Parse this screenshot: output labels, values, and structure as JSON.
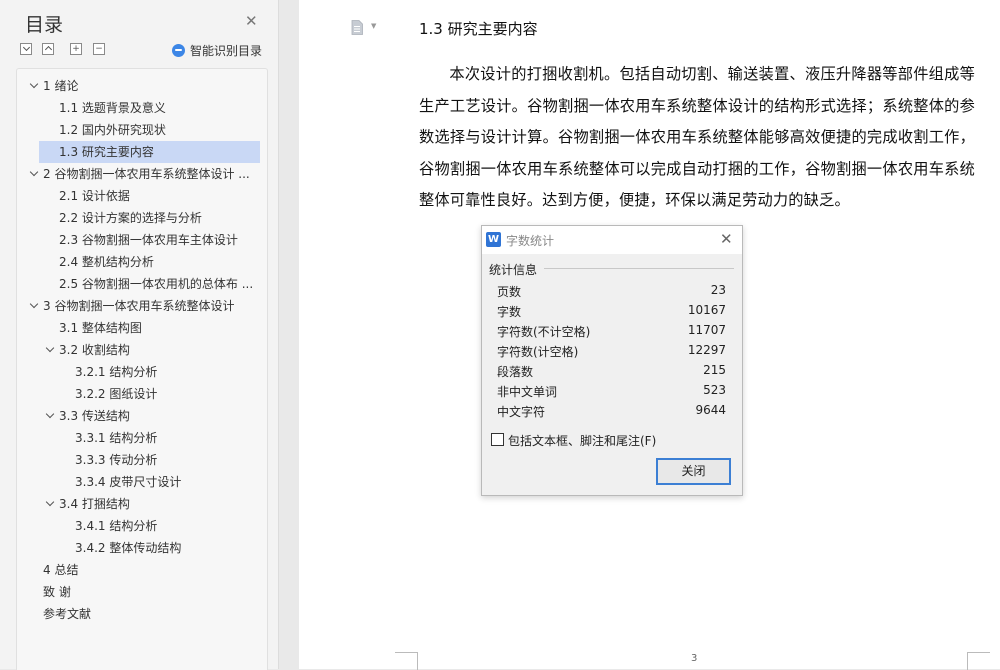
{
  "sidebar": {
    "title": "目录",
    "toolbar": {
      "collapse_all": "−",
      "expand": "+",
      "collapse": "−",
      "smart_label": "智能识别目录"
    },
    "items": [
      {
        "label": "1 绪论",
        "level": 0,
        "expander": "expanded"
      },
      {
        "label": "1.1 选题背景及意义",
        "level": 1
      },
      {
        "label": "1.2 国内外研究现状",
        "level": 1
      },
      {
        "label": "1.3 研究主要内容",
        "level": 1,
        "active": true
      },
      {
        "label": "2 谷物割捆一体农用车系统整体设计 ...",
        "level": 0,
        "expander": "expanded"
      },
      {
        "label": "2.1 设计依据",
        "level": 1
      },
      {
        "label": "2.2  设计方案的选择与分析",
        "level": 1
      },
      {
        "label": "2.3 谷物割捆一体农用车主体设计",
        "level": 1
      },
      {
        "label": "2.4 整机结构分析",
        "level": 1
      },
      {
        "label": "2.5 谷物割捆一体农用机的总体布 ...",
        "level": 1
      },
      {
        "label": "3 谷物割捆一体农用车系统整体设计",
        "level": 0,
        "expander": "expanded"
      },
      {
        "label": "3.1 整体结构图",
        "level": 1
      },
      {
        "label": "3.2 收割结构",
        "level": 1,
        "expander": "expanded"
      },
      {
        "label": "3.2.1 结构分析",
        "level": 2
      },
      {
        "label": "3.2.2 图纸设计",
        "level": 2
      },
      {
        "label": "3.3 传送结构",
        "level": 1,
        "expander": "expanded"
      },
      {
        "label": "3.3.1 结构分析",
        "level": 2
      },
      {
        "label": "3.3.3 传动分析",
        "level": 2
      },
      {
        "label": "3.3.4 皮带尺寸设计",
        "level": 2
      },
      {
        "label": "3.4 打捆结构",
        "level": 1,
        "expander": "expanded"
      },
      {
        "label": "3.4.1 结构分析",
        "level": 2
      },
      {
        "label": "3.4.2 整体传动结构",
        "level": 2
      },
      {
        "label": "4 总结",
        "level": 0
      },
      {
        "label": "致   谢",
        "level": 0
      },
      {
        "label": "参考文献",
        "level": 0
      }
    ]
  },
  "document": {
    "heading": "1.3 研究主要内容",
    "paragraph": "本次设计的打捆收割机。包括自动切割、输送装置、液压升降器等部件组成等生产工艺设计。谷物割捆一体农用车系统整体设计的结构形式选择；系统整体的参数选择与设计计算。谷物割捆一体农用车系统整体能够高效便捷的完成收割工作，谷物割捆一体农用车系统整体可以完成自动打捆的工作，谷物割捆一体农用车系统整体可靠性良好。达到方便，便捷，环保以满足劳动力的缺乏。",
    "page_number": "3"
  },
  "dialog": {
    "logo": "W",
    "title": "字数统计",
    "group_label": "统计信息",
    "stats": [
      {
        "label": "页数",
        "value": "23"
      },
      {
        "label": "字数",
        "value": "10167"
      },
      {
        "label": "字符数(不计空格)",
        "value": "11707"
      },
      {
        "label": "字符数(计空格)",
        "value": "12297"
      },
      {
        "label": "段落数",
        "value": "215"
      },
      {
        "label": "非中文单词",
        "value": "523"
      },
      {
        "label": "中文字符",
        "value": "9644"
      }
    ],
    "checkbox_label": "包括文本框、脚注和尾注(F)",
    "checkbox_checked": false,
    "close_button": "关闭"
  },
  "colors": {
    "accent": "#3c7fd4",
    "active_item": "#c9d8f5",
    "sidebar_bg": "#f3f3f3"
  }
}
